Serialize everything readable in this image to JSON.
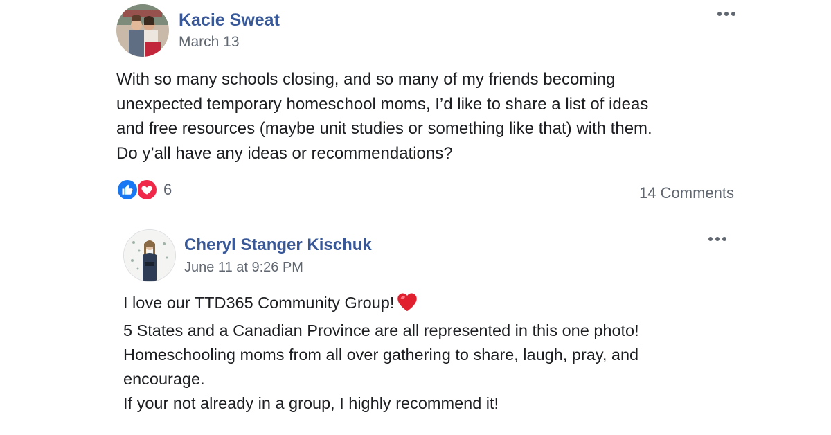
{
  "post": {
    "author": "Kacie Sweat",
    "date": "March 13",
    "body_lines": [
      "With so many schools closing, and so many of my friends becoming",
      "unexpected temporary homeschool moms, I’d like to share a list of ideas",
      "and free resources (maybe unit studies or something like that) with them.",
      "Do y’all have any ideas or recommendations?"
    ],
    "reaction_count": "6",
    "comments_label": "14 Comments",
    "reaction_icons": [
      "like-icon",
      "love-icon"
    ]
  },
  "comment": {
    "author": "Cheryl Stanger Kischuk",
    "date": "June 11 at 9:26 PM",
    "line1": "I love our TTD365 Community Group!",
    "body_lines": [
      "5 States and a Canadian Province are all represented in this one photo!",
      "Homeschooling moms from all over gathering to share, laugh, pray, and",
      "encourage.",
      "If your not already in a group, I highly recommend it!"
    ]
  },
  "colors": {
    "name_link": "#385898",
    "secondary_text": "#606770",
    "like_blue": "#1877f2",
    "love_red": "#f0284a"
  }
}
